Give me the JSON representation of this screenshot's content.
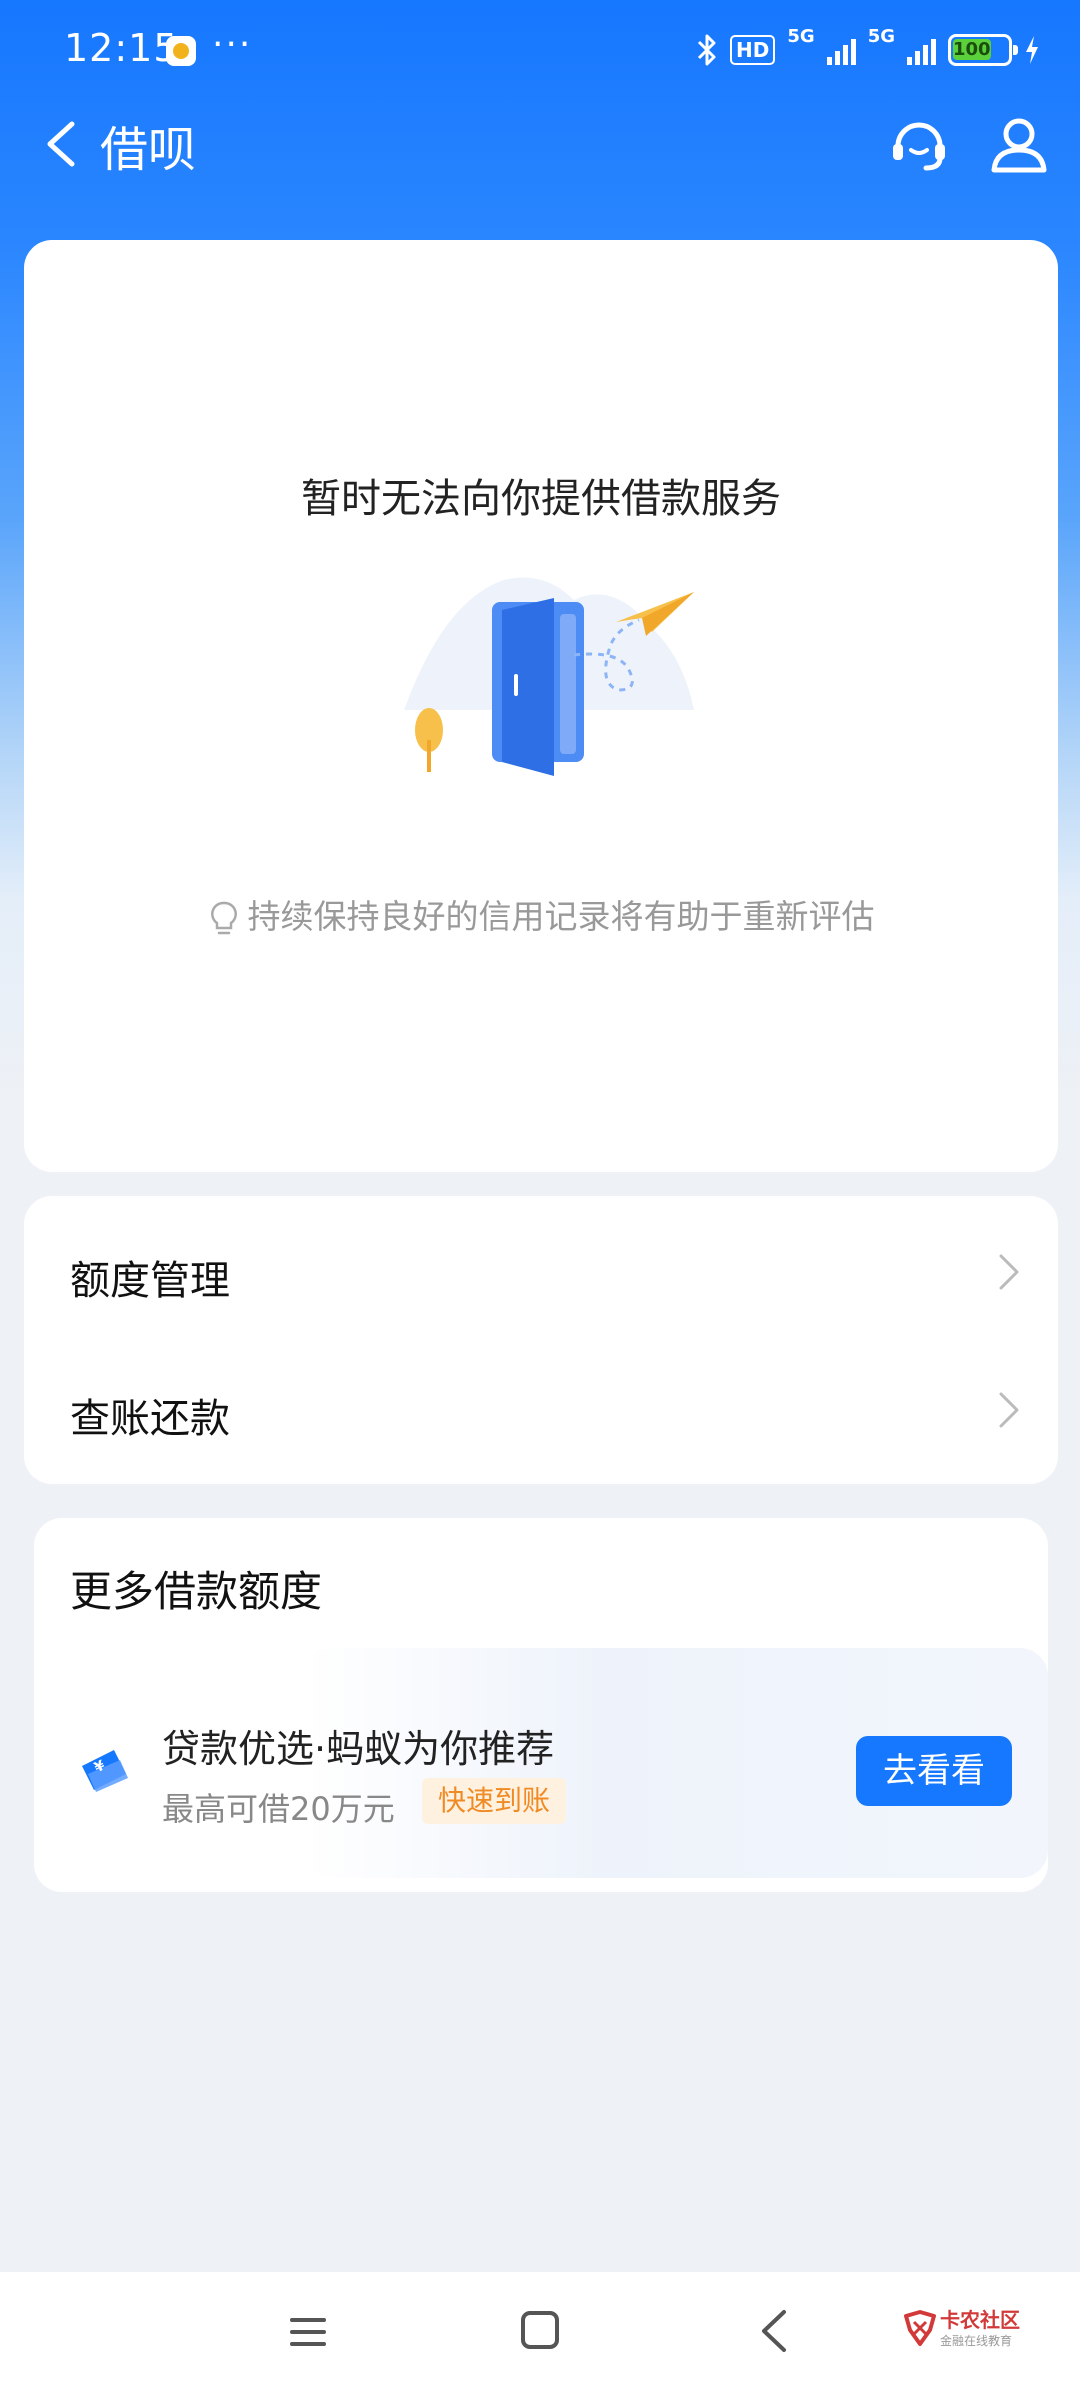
{
  "status_bar": {
    "time": "12:15",
    "more": "···",
    "hd": "HD",
    "network_1": "5G",
    "network_2": "5G",
    "battery": "100"
  },
  "nav": {
    "title": "借呗",
    "icons": [
      "back-icon",
      "customer-service-icon",
      "user-icon"
    ]
  },
  "status_card": {
    "title": "暂时无法向你提供借款服务",
    "tip": "持续保持良好的信用记录将有助于重新评估"
  },
  "menu": {
    "items": [
      {
        "label": "额度管理"
      },
      {
        "label": "查账还款"
      }
    ]
  },
  "more_credit": {
    "title": "更多借款额度",
    "promo": {
      "title": "贷款优选·蚂蚁为你推荐",
      "subtitle": "最高可借20万元",
      "tag": "快速到账",
      "button": "去看看"
    }
  },
  "watermark": {
    "name": "卡农社区",
    "sub": "金融在线教育"
  },
  "colors": {
    "primary": "#1677ff",
    "tag_text": "#f08a24",
    "tag_bg": "#fff1e0",
    "page_bg": "#eef1f6"
  }
}
